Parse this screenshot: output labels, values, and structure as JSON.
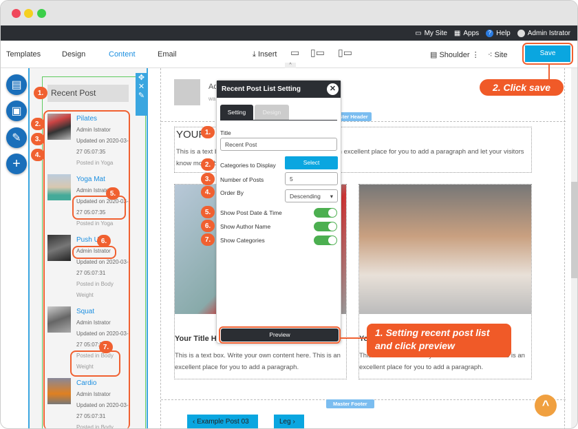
{
  "topbar": {
    "my_site": "My Site",
    "apps": "Apps",
    "help": "Help",
    "user": "Admin Istrator"
  },
  "toolbar": {
    "tabs": [
      "Templates",
      "Design",
      "Content",
      "Email"
    ],
    "insert": "Insert",
    "shoulder": "Shoulder",
    "site": "Site",
    "save": "Save"
  },
  "sidebar": {
    "title": "Recent Post",
    "posts": [
      {
        "title": "Pilates",
        "author": "Admin Istrator",
        "updated": "Updated on 2020-03-27 05:07:35",
        "category": "Posted in Yoga"
      },
      {
        "title": "Yoga Mat",
        "author": "Admin Istrator",
        "updated": "Updated on 2020-03-27 05:07:35",
        "category": "Posted in Yoga"
      },
      {
        "title": "Push Up",
        "author": "Admin Istrator",
        "updated": "Updated on 2020-03-27 05:07:31",
        "category": "Posted in Body Weight"
      },
      {
        "title": "Squat",
        "author": "Admin Istrator",
        "updated": "Updated on 2020-03-27 05:07:31",
        "category": "Posted in Body Weight"
      },
      {
        "title": "Cardio",
        "author": "Admin Istrator",
        "updated": "Updated on 2020-03-27 05:07:31",
        "category": "Posted in Body"
      }
    ]
  },
  "canvas": {
    "author_initial": "Ad",
    "author_sub": "wa",
    "master_header": "Master Header",
    "heading": "YOUR",
    "paragraph": "This is a text box. Write your own content here. This is an excellent place for you to add a paragraph and let your visitors know more about you.",
    "col_title": "Your Title H",
    "col_title2": "Yo",
    "col_para": "This is a text box. Write your own content here. This is an excellent place for you to add a paragraph.",
    "master_footer": "Master Footer",
    "prev_post": "Example Post 03",
    "next_post": "Leg"
  },
  "modal": {
    "title": "Recent Post List Setting",
    "tabs": [
      "Setting",
      "Design"
    ],
    "title_label": "Title",
    "title_value": "Recent Post",
    "categories_label": "Categories to Display",
    "select": "Select",
    "num_label": "Number of Posts",
    "num_value": "5",
    "order_label": "Order By",
    "order_value": "Descending",
    "show_date": "Show Post Date & Time",
    "show_author": "Show Author Name",
    "show_categories": "Show Categories",
    "toggles": {
      "date": true,
      "author": true,
      "categories": true
    },
    "preview": "Preview"
  },
  "annotations": {
    "save": "2. Click save",
    "preview": "1. Setting recent post list and click preview",
    "badges": [
      "1.",
      "2.",
      "3.",
      "4.",
      "5.",
      "6.",
      "7."
    ]
  },
  "colors": {
    "accent": "#0aa6e0",
    "annotation": "#f05a28",
    "dark": "#2b2e33"
  }
}
